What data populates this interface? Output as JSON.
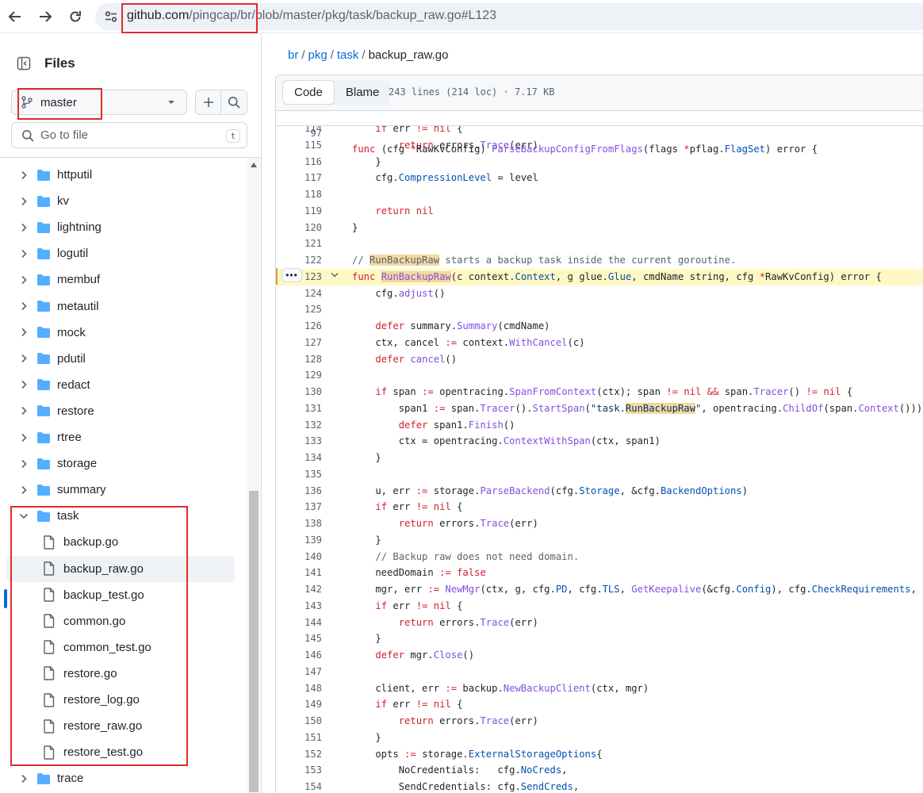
{
  "browser": {
    "url_host": "github.com",
    "url_path": "/pingcap/br/blob/master/pkg/task/backup_raw.go#L123"
  },
  "sidebar": {
    "title": "Files",
    "branch": "master",
    "goto_placeholder": "Go to file",
    "goto_shortcut": "t",
    "tree": [
      {
        "type": "folder",
        "name": "httputil",
        "open": false
      },
      {
        "type": "folder",
        "name": "kv",
        "open": false
      },
      {
        "type": "folder",
        "name": "lightning",
        "open": false
      },
      {
        "type": "folder",
        "name": "logutil",
        "open": false
      },
      {
        "type": "folder",
        "name": "membuf",
        "open": false
      },
      {
        "type": "folder",
        "name": "metautil",
        "open": false
      },
      {
        "type": "folder",
        "name": "mock",
        "open": false
      },
      {
        "type": "folder",
        "name": "pdutil",
        "open": false
      },
      {
        "type": "folder",
        "name": "redact",
        "open": false
      },
      {
        "type": "folder",
        "name": "restore",
        "open": false
      },
      {
        "type": "folder",
        "name": "rtree",
        "open": false
      },
      {
        "type": "folder",
        "name": "storage",
        "open": false
      },
      {
        "type": "folder",
        "name": "summary",
        "open": false
      },
      {
        "type": "folder",
        "name": "task",
        "open": true
      },
      {
        "type": "file",
        "name": "backup.go"
      },
      {
        "type": "file",
        "name": "backup_raw.go",
        "active": true
      },
      {
        "type": "file",
        "name": "backup_test.go"
      },
      {
        "type": "file",
        "name": "common.go"
      },
      {
        "type": "file",
        "name": "common_test.go"
      },
      {
        "type": "file",
        "name": "restore.go"
      },
      {
        "type": "file",
        "name": "restore_log.go"
      },
      {
        "type": "file",
        "name": "restore_raw.go"
      },
      {
        "type": "file",
        "name": "restore_test.go"
      },
      {
        "type": "folder",
        "name": "trace",
        "open": false
      }
    ]
  },
  "breadcrumb": {
    "parts": [
      "br",
      "pkg",
      "task"
    ],
    "current": "backup_raw.go"
  },
  "file_header": {
    "code_tab": "Code",
    "blame_tab": "Blame",
    "meta": "243 lines (214 loc) · 7.17 KB"
  },
  "code": {
    "sticky": {
      "n": "97",
      "text": "func (cfg *RawKvConfig) ParseBackupConfigFromFlags(flags *pflag.FlagSet) error {"
    },
    "highlight_line": "123",
    "lines": [
      {
        "n": "114",
        "text": "    if err != nil {"
      },
      {
        "n": "115",
        "text": "        return errors.Trace(err)"
      },
      {
        "n": "116",
        "text": "    }"
      },
      {
        "n": "117",
        "text": "    cfg.CompressionLevel = level"
      },
      {
        "n": "118",
        "text": ""
      },
      {
        "n": "119",
        "text": "    return nil"
      },
      {
        "n": "120",
        "text": "}"
      },
      {
        "n": "121",
        "text": ""
      },
      {
        "n": "122",
        "text": "// RunBackupRaw starts a backup task inside the current goroutine."
      },
      {
        "n": "123",
        "text": "func RunBackupRaw(c context.Context, g glue.Glue, cmdName string, cfg *RawKvConfig) error {"
      },
      {
        "n": "124",
        "text": "    cfg.adjust()"
      },
      {
        "n": "125",
        "text": ""
      },
      {
        "n": "126",
        "text": "    defer summary.Summary(cmdName)"
      },
      {
        "n": "127",
        "text": "    ctx, cancel := context.WithCancel(c)"
      },
      {
        "n": "128",
        "text": "    defer cancel()"
      },
      {
        "n": "129",
        "text": ""
      },
      {
        "n": "130",
        "text": "    if span := opentracing.SpanFromContext(ctx); span != nil && span.Tracer() != nil {"
      },
      {
        "n": "131",
        "text": "        span1 := span.Tracer().StartSpan(\"task.RunBackupRaw\", opentracing.ChildOf(span.Context()))"
      },
      {
        "n": "132",
        "text": "        defer span1.Finish()"
      },
      {
        "n": "133",
        "text": "        ctx = opentracing.ContextWithSpan(ctx, span1)"
      },
      {
        "n": "134",
        "text": "    }"
      },
      {
        "n": "135",
        "text": ""
      },
      {
        "n": "136",
        "text": "    u, err := storage.ParseBackend(cfg.Storage, &cfg.BackendOptions)"
      },
      {
        "n": "137",
        "text": "    if err != nil {"
      },
      {
        "n": "138",
        "text": "        return errors.Trace(err)"
      },
      {
        "n": "139",
        "text": "    }"
      },
      {
        "n": "140",
        "text": "    // Backup raw does not need domain."
      },
      {
        "n": "141",
        "text": "    needDomain := false"
      },
      {
        "n": "142",
        "text": "    mgr, err := NewMgr(ctx, g, cfg.PD, cfg.TLS, GetKeepalive(&cfg.Config), cfg.CheckRequirements, needDomain)"
      },
      {
        "n": "143",
        "text": "    if err != nil {"
      },
      {
        "n": "144",
        "text": "        return errors.Trace(err)"
      },
      {
        "n": "145",
        "text": "    }"
      },
      {
        "n": "146",
        "text": "    defer mgr.Close()"
      },
      {
        "n": "147",
        "text": ""
      },
      {
        "n": "148",
        "text": "    client, err := backup.NewBackupClient(ctx, mgr)"
      },
      {
        "n": "149",
        "text": "    if err != nil {"
      },
      {
        "n": "150",
        "text": "        return errors.Trace(err)"
      },
      {
        "n": "151",
        "text": "    }"
      },
      {
        "n": "152",
        "text": "    opts := storage.ExternalStorageOptions{"
      },
      {
        "n": "153",
        "text": "        NoCredentials:   cfg.NoCreds,"
      },
      {
        "n": "154",
        "text": "        SendCredentials: cfg.SendCreds,"
      }
    ]
  },
  "colors": {
    "accent": "#0969da",
    "highlight_bg": "#fff8c5",
    "annotation_red": "#e02b2b"
  }
}
